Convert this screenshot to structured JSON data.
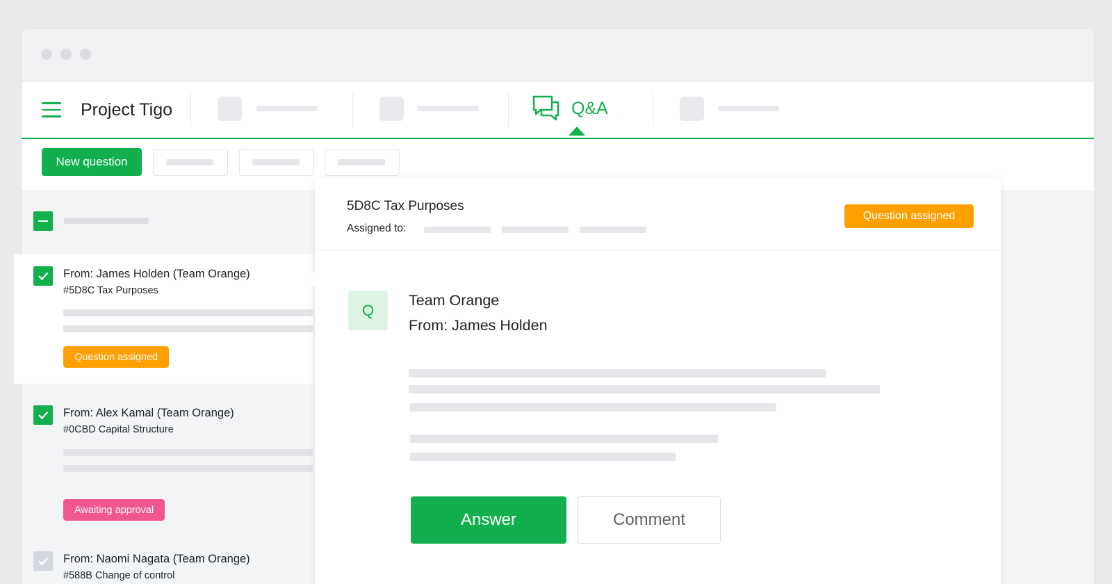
{
  "colors": {
    "accent": "#11b04c",
    "orange": "#ff9f00",
    "pink": "#f0578e"
  },
  "header": {
    "menu_icon": "hamburger-icon",
    "project_title": "Project Tigo"
  },
  "tabs": {
    "active": {
      "label": "Q&A",
      "icon": "chat-bubbles-icon"
    }
  },
  "toolbar": {
    "new_question_label": "New question"
  },
  "questions": [
    {
      "from": "From: James Holden (Team Orange)",
      "ref": "#5D8C Tax Purposes",
      "status": "Question assigned",
      "checked": true
    },
    {
      "from": "From: Alex Kamal (Team Orange)",
      "ref": "#0CBD Capital Structure",
      "status": "Awaiting approval",
      "checked": true
    },
    {
      "from": "From: Naomi Nagata (Team Orange)",
      "ref": "#588B Change of control",
      "checked": false
    }
  ],
  "detail": {
    "title": "5D8C Tax Purposes",
    "assigned_label": "Assigned to:",
    "status": "Question assigned",
    "avatar_letter": "Q",
    "team": "Team Orange",
    "from": "From: James Holden",
    "answer_label": "Answer",
    "comment_label": "Comment"
  }
}
